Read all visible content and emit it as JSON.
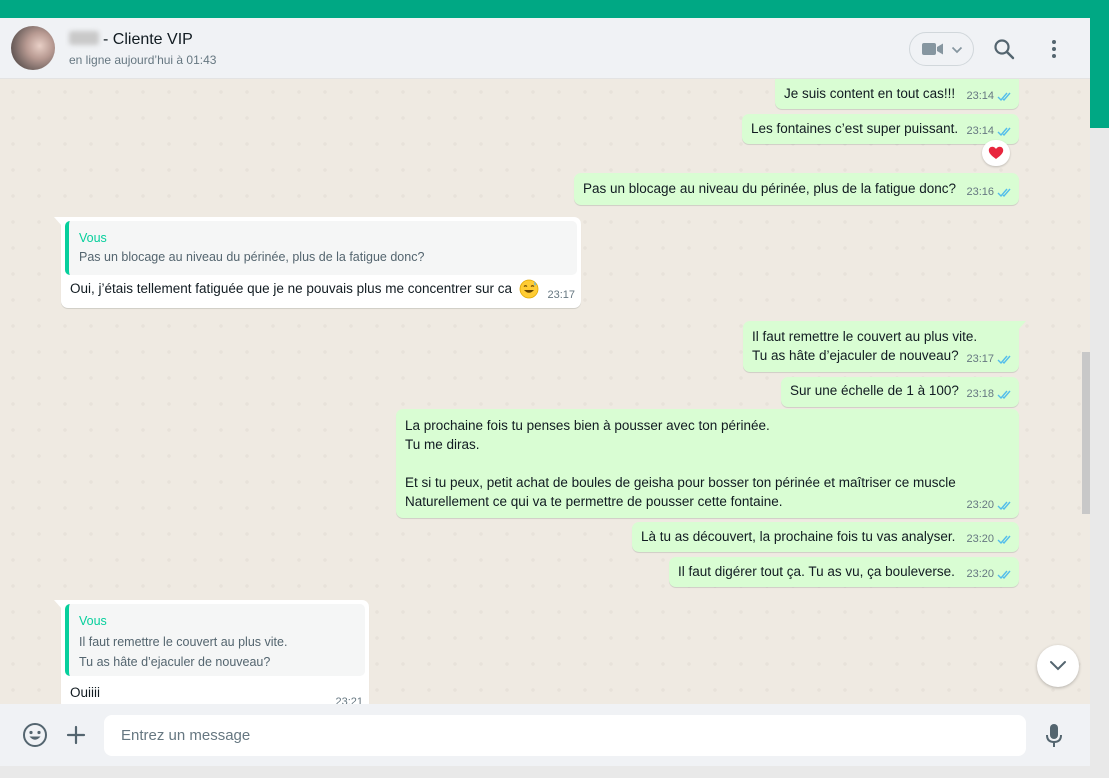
{
  "header": {
    "contact_name": "- Cliente VIP",
    "status": "en ligne aujourd’hui à 01:43",
    "icons": [
      "avatar",
      "video-call-icon",
      "chevron-down-icon",
      "search-icon",
      "menu-icon"
    ]
  },
  "messages": [
    {
      "dir": "out",
      "text": "Je suis content en tout cas!!!",
      "time": "23:14"
    },
    {
      "dir": "out",
      "text": "Les fontaines c’est super puissant.",
      "time": "23:14",
      "reaction": "❤️"
    },
    {
      "dir": "out",
      "text": "Pas un blocage au niveau du périnée, plus de la fatigue donc?",
      "time": "23:16"
    },
    {
      "dir": "in",
      "quote_author": "Vous",
      "quote_text": "Pas un blocage au niveau du périnée, plus de la fatigue donc?",
      "text": "Oui, j’étais tellement fatiguée que je ne pouvais plus me concentrer sur ca",
      "emoji": "😅",
      "time": "23:17"
    },
    {
      "dir": "out",
      "text": "Il faut remettre le couvert au plus vite.\nTu as hâte d’ejaculer de nouveau?",
      "time": "23:17"
    },
    {
      "dir": "out",
      "text": "Sur une échelle de 1 à 100?",
      "time": "23:18"
    },
    {
      "dir": "out",
      "text": "La prochaine fois tu penses bien à pousser avec ton périnée.\nTu me diras.\n\nEt si tu peux, petit achat de boules de geisha pour bosser ton périnée et maîtriser ce muscle\nNaturellement ce qui va te permettre de pousser cette fontaine.",
      "time": "23:20"
    },
    {
      "dir": "out",
      "text": "Là tu as découvert, la prochaine fois tu vas analyser.",
      "time": "23:20"
    },
    {
      "dir": "out",
      "text": "Il faut digérer tout ça. Tu as vu, ça bouleverse.",
      "time": "23:20"
    },
    {
      "dir": "in",
      "quote_author": "Vous",
      "quote_text": "Il faut remettre le couvert au plus vite.\nTu as hâte d’ejaculer de nouveau?",
      "text": "Ouiiii",
      "time": "23:21"
    }
  ],
  "footer": {
    "placeholder": "Entrez un message",
    "icons": [
      "emoji-icon",
      "plus-icon",
      "microphone-icon"
    ]
  },
  "colors": {
    "accent": "#00a884",
    "outgoing_bubble": "#d9fdd3",
    "incoming_bubble": "#ffffff",
    "chat_background": "#efeae2",
    "read_ticks": "#53bdeb",
    "quote_accent": "#06cf9c"
  }
}
